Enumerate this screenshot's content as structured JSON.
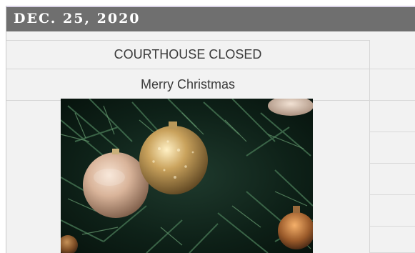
{
  "event": {
    "date": "DEC. 25, 2020",
    "status": "COURTHOUSE CLOSED",
    "greeting": "Merry Christmas"
  },
  "photo": {
    "subject": "christmas-ornaments"
  },
  "colors": {
    "header_bg": "#6f6f6f",
    "header_accent": "#d9d2e6",
    "cell_bg": "#f2f2f2",
    "text": "#3a3a3a"
  }
}
